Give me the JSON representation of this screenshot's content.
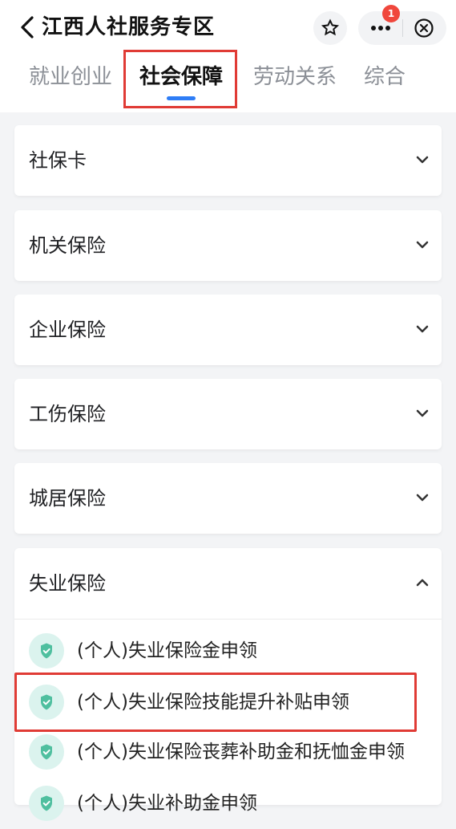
{
  "header": {
    "title": "江西人社服务专区",
    "notification_count": "1"
  },
  "tabs": [
    {
      "label": "就业创业"
    },
    {
      "label": "社会保障"
    },
    {
      "label": "劳动关系"
    },
    {
      "label": "综合"
    }
  ],
  "active_tab": "社会保障",
  "sections": [
    {
      "label": "社保卡",
      "expanded": false
    },
    {
      "label": "机关保险",
      "expanded": false
    },
    {
      "label": "企业保险",
      "expanded": false
    },
    {
      "label": "工伤保险",
      "expanded": false
    },
    {
      "label": "城居保险",
      "expanded": false
    },
    {
      "label": "失业保险",
      "expanded": true
    }
  ],
  "services": [
    {
      "label": "(个人)失业保险金申领"
    },
    {
      "label": "(个人)失业保险技能提升补贴申领"
    },
    {
      "label": "(个人)失业保险丧葬补助金和抚恤金申领"
    },
    {
      "label": "(个人)失业补助金申领"
    }
  ],
  "colors": {
    "accent_blue": "#2e7df6",
    "highlight_red": "#e03b35",
    "shield_green": "#4fbf9f",
    "badge_red": "#f0473c"
  },
  "icons": {
    "back": "back-arrow-icon",
    "star": "star-icon",
    "more": "more-icon",
    "close": "close-icon",
    "chevron_down": "chevron-down-icon",
    "chevron_up": "chevron-up-icon",
    "shield": "shield-check-icon"
  }
}
